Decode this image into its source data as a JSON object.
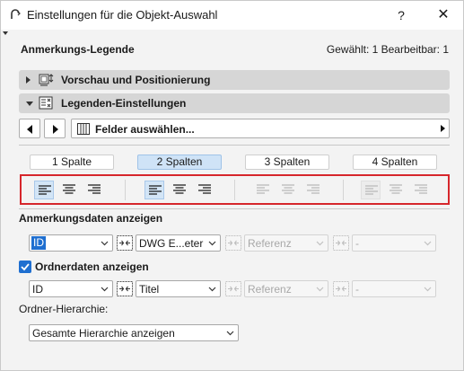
{
  "window": {
    "title": "Einstellungen für die Objekt-Auswahl",
    "help_label": "?",
    "close_label": "✕"
  },
  "header": {
    "legend_title": "Anmerkungs-Legende",
    "status": "Gewählt: 1 Bearbeitbar: 1"
  },
  "sections": {
    "preview": {
      "label": "Vorschau und Positionierung",
      "expanded": false,
      "icon": "preview-layout-icon"
    },
    "legend": {
      "label": "Legenden-Einstellungen",
      "expanded": true,
      "icon": "legend-settings-icon"
    }
  },
  "field_selector": {
    "label": "Felder auswählen..."
  },
  "columns": {
    "options": [
      "1 Spalte",
      "2 Spalten",
      "3 Spalten",
      "4 Spalten"
    ],
    "selected_index": 1
  },
  "alignment_groups": [
    {
      "enabled": true,
      "selected": "left"
    },
    {
      "enabled": true,
      "selected": "left"
    },
    {
      "enabled": false,
      "selected": "none"
    },
    {
      "enabled": false,
      "selected": "none"
    }
  ],
  "annotation_data": {
    "heading": "Anmerkungsdaten anzeigen",
    "row": [
      "ID",
      "DWG E...eter",
      "Referenz",
      "-"
    ]
  },
  "folder_data": {
    "checkbox_label": "Ordnerdaten anzeigen",
    "checked": true,
    "row": [
      "ID",
      "Titel",
      "Referenz",
      "-"
    ]
  },
  "hierarchy": {
    "label": "Ordner-Hierarchie:",
    "value": "Gesamte Hierarchie anzeigen"
  },
  "colors": {
    "accent": "#1f6fd0",
    "highlight_frame": "#d6262b",
    "selected_column": "#cfe3f7"
  }
}
